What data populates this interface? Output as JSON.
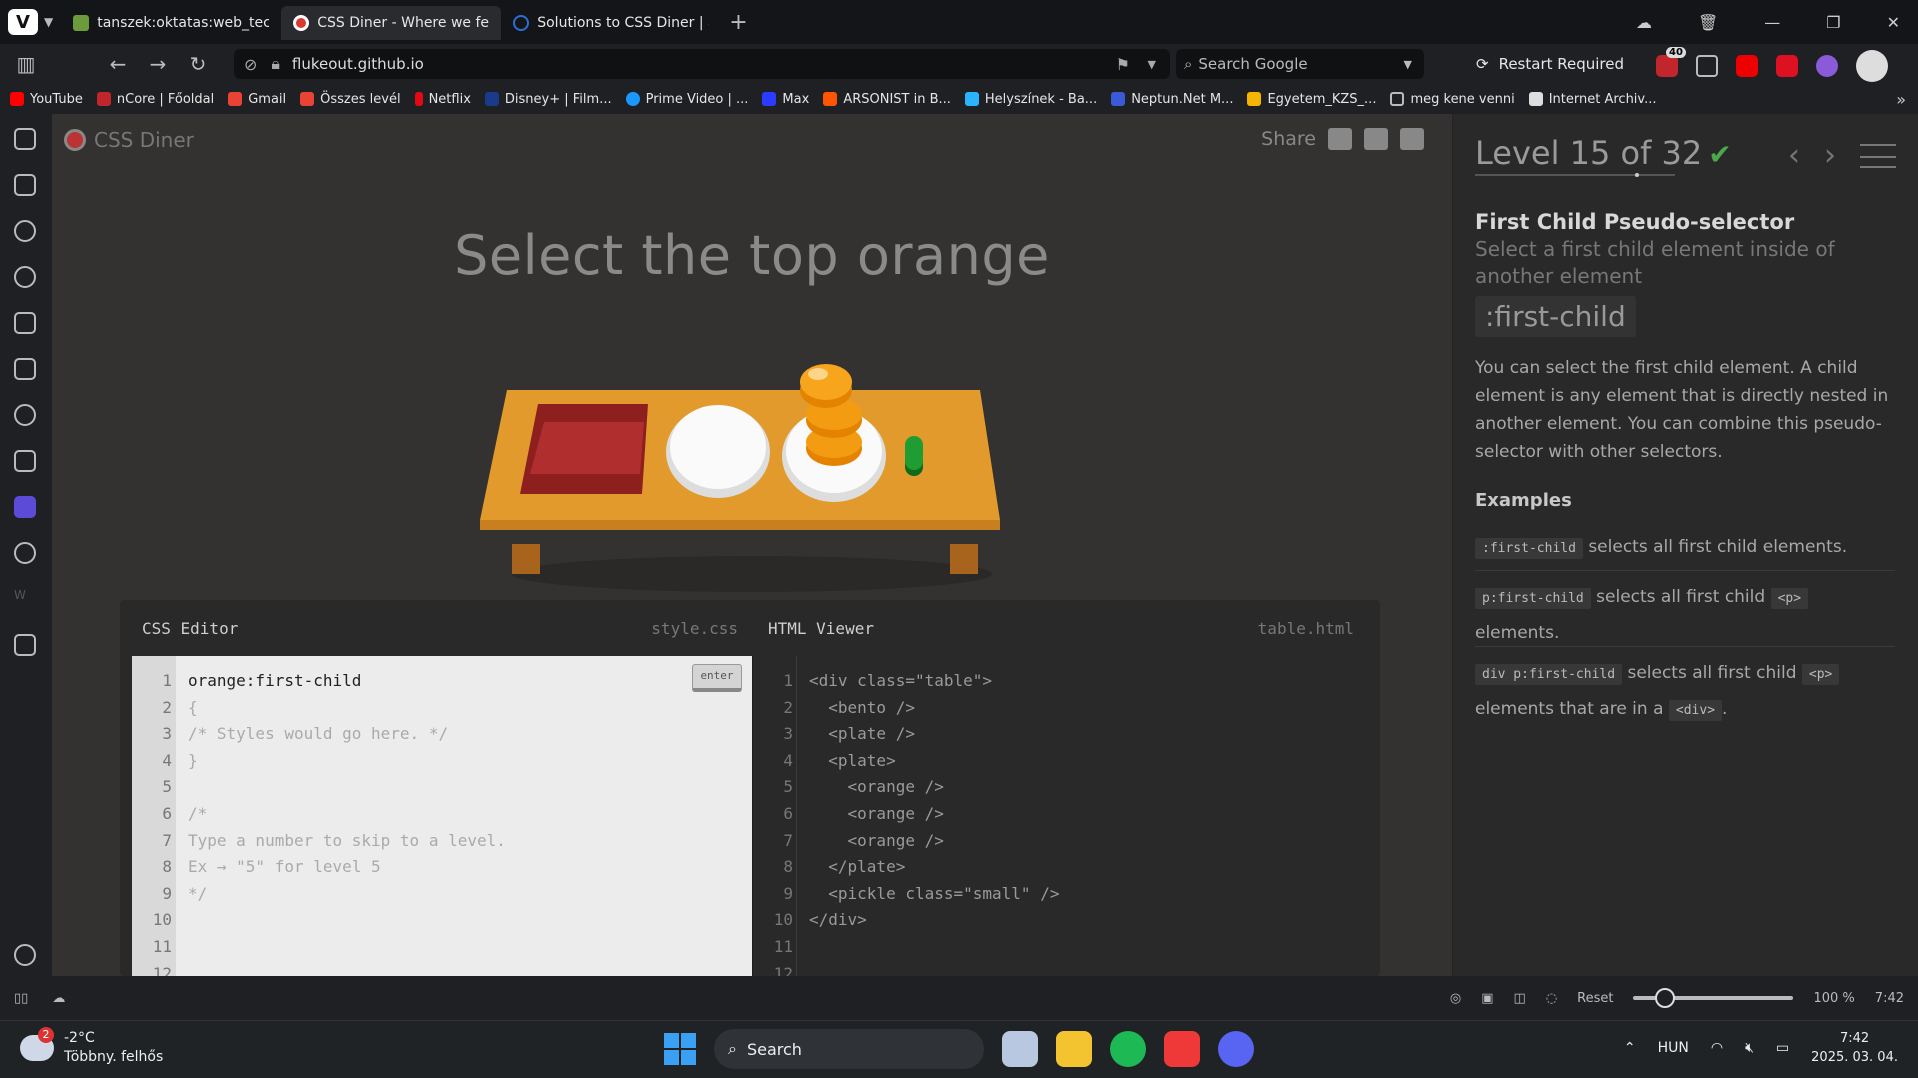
{
  "browser": {
    "tabs": [
      {
        "title": "tanszek:oktatas:web_techno",
        "favicon_color": "#6b9b3a",
        "active": false
      },
      {
        "title": "CSS Diner - Where we feast",
        "favicon_color": "#d83a2f",
        "active": true
      },
      {
        "title": "Solutions to CSS Diner | anc",
        "favicon_color": "#2a6fd3",
        "active": false
      }
    ],
    "url_domain": "flukeout.github.io",
    "search_placeholder": "Search Google",
    "restart_label": "Restart Required",
    "extension_badge": "40"
  },
  "bookmarks": [
    {
      "label": "YouTube",
      "color": "#ff0000"
    },
    {
      "label": "nCore | Főoldal",
      "color": "#c0262b"
    },
    {
      "label": "Gmail",
      "color": "#ea4335"
    },
    {
      "label": "Összes levél",
      "color": "#ea4335"
    },
    {
      "label": "Netflix",
      "color": "#e50914"
    },
    {
      "label": "Disney+ | Film...",
      "color": "#1a3a8c"
    },
    {
      "label": "Prime Video | ...",
      "color": "#1a98ff"
    },
    {
      "label": "Max",
      "color": "#2b3bff"
    },
    {
      "label": "ARSONIST in B...",
      "color": "#ff5500"
    },
    {
      "label": "Helyszínek - Ba...",
      "color": "#2ab3ff"
    },
    {
      "label": "Neptun.Net M...",
      "color": "#3a5ad8"
    },
    {
      "label": "Egyetem_KZS_...",
      "color": "#f4b400"
    },
    {
      "label": "meg kene venni",
      "color": "#bbbbbb"
    },
    {
      "label": "Internet Archiv...",
      "color": "#dddddd"
    }
  ],
  "page": {
    "logo": "CSS Diner",
    "share_label": "Share",
    "instruction": "Select the top orange"
  },
  "editor": {
    "css_title": "CSS Editor",
    "css_file": "style.css",
    "html_title": "HTML Viewer",
    "html_file": "table.html",
    "enter_label": "enter",
    "line_numbers": [
      "1",
      "2",
      "3",
      "4",
      "5",
      "6",
      "7",
      "8",
      "9",
      "10",
      "11",
      "12"
    ],
    "css_lines": [
      "orange:first-child",
      "{",
      "/* Styles would go here. */",
      "}",
      "",
      "/*",
      "Type a number to skip to a level.",
      "Ex → \"5\" for level 5",
      "*/",
      "",
      ""
    ],
    "html_lines": [
      "<div class=\"table\">",
      "  <bento />",
      "  <plate />",
      "  <plate>",
      "    <orange />",
      "    <orange />",
      "    <orange />",
      "  </plate>",
      "  <pickle class=\"small\" />",
      "</div>",
      ""
    ]
  },
  "sidebar": {
    "level_label": "Level 15 of 32",
    "level_progress": 0.47,
    "title": "First Child Pseudo-selector",
    "subtitle": "Select a first child element inside of another element",
    "syntax": ":first-child",
    "description": "You can select the first child element. A child element is any element that is directly nested in another element. You can combine this pseudo-selector with other selectors.",
    "examples_heading": "Examples",
    "examples": [
      {
        "code": ":first-child",
        "text": " selects all first child elements."
      },
      {
        "code": "p:first-child",
        "text": " selects all first child ",
        "code2": "<p>",
        "text2": " elements."
      },
      {
        "code": "div p:first-child",
        "text": " selects all first child ",
        "code2": "<p>",
        "text2": " elements that are in a ",
        "code3": "<div>",
        "text3": "."
      }
    ]
  },
  "statusbar": {
    "reset_label": "Reset",
    "zoom": "100 %",
    "time": "7:42"
  },
  "taskbar": {
    "weather_badge": "2",
    "temperature": "-2°C",
    "weather_desc": "Többny. felhős",
    "search_label": "Search",
    "language": "HUN",
    "clock_time": "7:42",
    "clock_date": "2025. 03. 04."
  }
}
